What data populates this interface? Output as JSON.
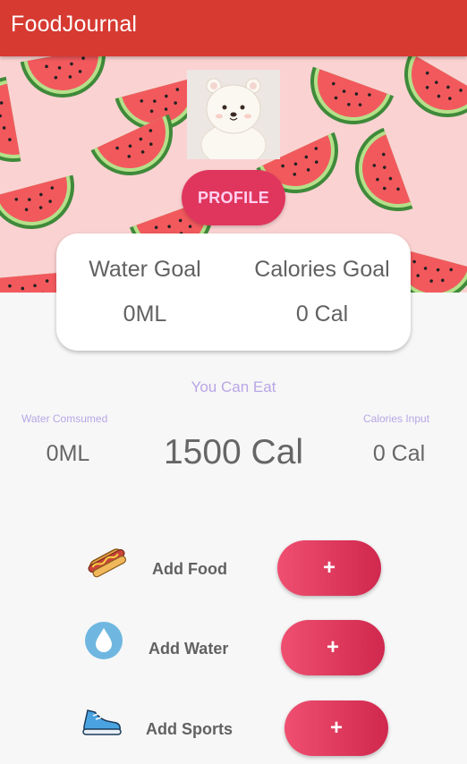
{
  "app": {
    "title": "FoodJournal"
  },
  "profile": {
    "button_label": "PROFILE"
  },
  "goals": {
    "water_label": "Water Goal",
    "water_value": "0ML",
    "calories_label": "Calories Goal",
    "calories_value": "0 Cal"
  },
  "summary": {
    "heading": "You Can Eat",
    "water_label": "Water Comsumed",
    "water_value": "0ML",
    "remaining_value": "1500 Cal",
    "calories_label": "Calories Input",
    "calories_value": "0 Cal"
  },
  "actions": [
    {
      "icon": "hotdog-icon",
      "label": "Add Food",
      "button": "+"
    },
    {
      "icon": "water-drop-icon",
      "label": "Add Water",
      "button": "+"
    },
    {
      "icon": "sneaker-icon",
      "label": "Add Sports",
      "button": "+"
    }
  ],
  "colors": {
    "appbar": "#d63a31",
    "banner_bg": "#fbd2d2",
    "profile_button": "#e0365d",
    "accent_text": "#b8a6e6",
    "plus_button": "#e03a5f"
  }
}
